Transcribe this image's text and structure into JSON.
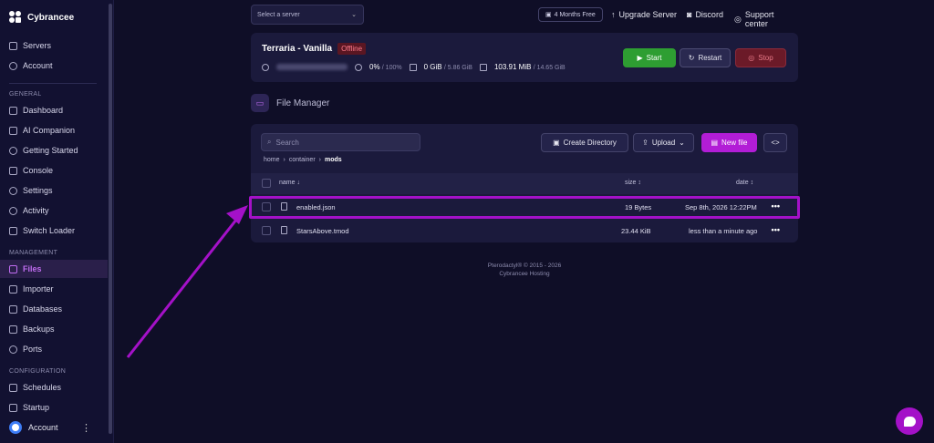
{
  "brand": {
    "name": "Cybrancee"
  },
  "sidebar": {
    "top_items": [
      {
        "label": "Servers",
        "icon": "server-icon"
      },
      {
        "label": "Account",
        "icon": "user-icon"
      }
    ],
    "sections": [
      {
        "title": "GENERAL",
        "items": [
          "Dashboard",
          "AI Companion",
          "Getting Started",
          "Console",
          "Settings",
          "Activity",
          "Switch Loader"
        ]
      },
      {
        "title": "MANAGEMENT",
        "items": [
          "Files",
          "Importer",
          "Databases",
          "Backups",
          "Ports"
        ]
      },
      {
        "title": "CONFIGURATION",
        "items": [
          "Schedules",
          "Startup"
        ]
      }
    ],
    "active_item": "Files",
    "footer_account": "Account"
  },
  "topbar": {
    "server_select_placeholder": "Select a server",
    "promo_pill": "4 Months Free",
    "links": [
      "Upgrade Server",
      "Discord",
      "Support center"
    ]
  },
  "server": {
    "name": "Terraria - Vanilla",
    "status": "Offline",
    "cpu": "0%",
    "cpu_limit": "/ 100%",
    "memory": "0 GiB",
    "memory_limit": "/ 5.86 GiB",
    "disk": "103.91 MiB",
    "disk_limit": "/ 14.65 GiB",
    "buttons": {
      "start": "Start",
      "restart": "Restart",
      "stop": "Stop"
    }
  },
  "file_manager": {
    "title": "File Manager",
    "search_placeholder": "Search",
    "toolbar": {
      "create_directory": "Create Directory",
      "upload": "Upload",
      "new_file": "New file",
      "code": "<>"
    },
    "breadcrumb": [
      "home",
      "container",
      "mods"
    ],
    "columns": {
      "name": "name ↓",
      "size": "size ↕",
      "date": "date ↕"
    },
    "rows": [
      {
        "name": "enabled.json",
        "size": "19 Bytes",
        "date": "Sep 8th, 2026 12:22PM"
      },
      {
        "name": "StarsAbove.tmod",
        "size": "23.44 KiB",
        "date": "less than a minute ago"
      }
    ]
  },
  "footer": {
    "line1": "Pterodactyl® © 2015 - 2026",
    "line2": "Cybrancee Hosting"
  },
  "colors": {
    "accent": "#a411c8",
    "start": "#2e9e32",
    "stop": "#6b1a28",
    "background": "#0f0e27"
  }
}
